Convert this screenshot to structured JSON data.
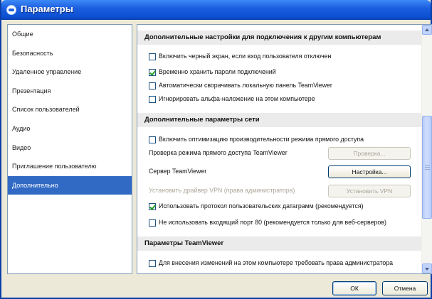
{
  "window": {
    "title": "Параметры"
  },
  "nav": {
    "items": [
      "Общие",
      "Безопасность",
      "Удаленное управление",
      "Презентация",
      "Список пользователей",
      "Аудио",
      "Видео",
      "Приглашение пользователю",
      "Дополнительно"
    ],
    "selected": "Дополнительно"
  },
  "sections": {
    "s1": {
      "header": "Дополнительные настройки для подключения к другим компьютерам",
      "options": [
        {
          "label": "Включить черный экран, если вход пользователя отключен",
          "checked": false
        },
        {
          "label": "Временно хранить пароли подключений",
          "checked": true
        },
        {
          "label": "Автоматически сворачивать локальную панель TeamViewer",
          "checked": false
        },
        {
          "label": "Игнорировать альфа-наложение на этом компьютере",
          "checked": false
        }
      ]
    },
    "s2": {
      "header": "Дополнительные параметры сети",
      "option_direct": "Включить оптимизацию производительности режима прямого доступа",
      "option_direct_checked": false,
      "check_label": "Проверка режима прямого доступа TeamViewer",
      "check_button": "Проверка...",
      "server_label": "Сервер TeamViewer",
      "server_button": "Настройка...",
      "vpn_label": "Установить драйвер VPN (права администратора)",
      "vpn_button": "Установить VPN",
      "option_udp": "Использовать протокол пользовательских датаграмм (рекомендуется)",
      "option_udp_checked": true,
      "option_port80": "Не использовать входящий порт 80 (рекомендуется только для веб-серверов)",
      "option_port80_checked": false
    },
    "s3": {
      "header": "Параметры TeamViewer",
      "option_admin": "Для внесения изменений на этом компьютере требовать права администратора",
      "option_admin_checked": false
    }
  },
  "footer": {
    "ok": "ОК",
    "cancel": "Отмена"
  },
  "colors": {
    "titlebar": "#0b4fd2",
    "selected": "#316ac5",
    "section_bg": "#ebebeb"
  }
}
